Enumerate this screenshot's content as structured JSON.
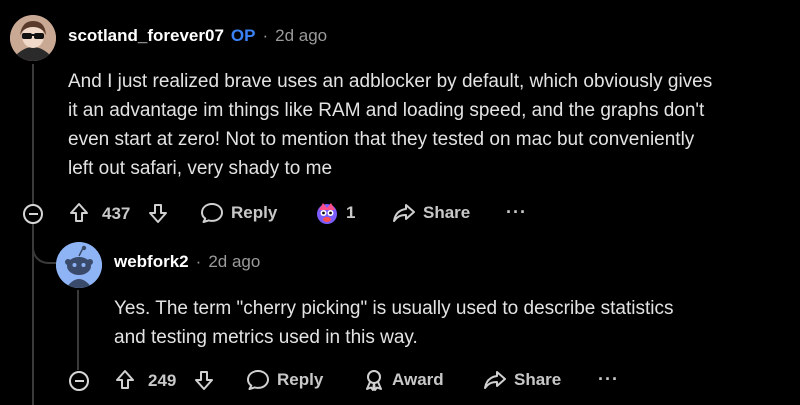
{
  "comment1": {
    "username": "scotland_forever07",
    "op_badge": "OP",
    "separator": "·",
    "time": "2d ago",
    "body_lines": [
      "And I just realized brave uses an adblocker by default, which obviously gives",
      "it an advantage im things like RAM and loading speed, and the graphs don't",
      "even start at zero! Not to mention that they tested on mac but conveniently",
      "left out safari, very shady to me"
    ],
    "score": "437",
    "reply_label": "Reply",
    "award_count": "1",
    "share_label": "Share",
    "more_label": "···"
  },
  "comment2": {
    "username": "webfork2",
    "separator": "·",
    "time": "2d ago",
    "body_lines": [
      "Yes. The term \"cherry picking\" is usually used to describe statistics",
      "and testing metrics used in this way."
    ],
    "score": "249",
    "reply_label": "Reply",
    "award_label": "Award",
    "share_label": "Share",
    "more_label": "···"
  },
  "colors": {
    "background": "#000000",
    "op_blue": "#3b82f6",
    "muted": "#9a9a9a",
    "avatar2_blue": "#8fb4f5"
  }
}
